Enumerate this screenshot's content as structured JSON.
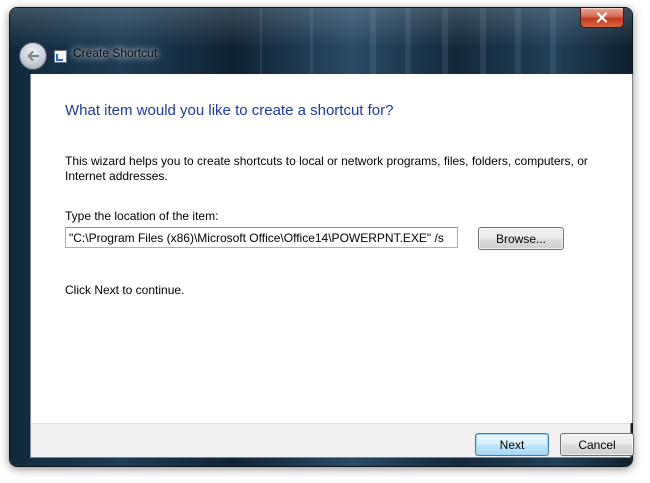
{
  "window": {
    "title": "Create Shortcut"
  },
  "titlebar": {
    "close_icon": "close-icon",
    "back_icon": "back-arrow-icon",
    "app_icon": "shortcut-icon"
  },
  "wizard": {
    "heading": "What item would you like to create a shortcut for?",
    "description": "This wizard helps you to create shortcuts to local or network programs, files, folders, computers, or Internet addresses.",
    "location_label": "Type the location of the item:",
    "location_value": "\"C:\\Program Files (x86)\\Microsoft Office\\Office14\\POWERPNT.EXE\" /s",
    "browse_label": "Browse...",
    "continue_text": "Click Next to continue."
  },
  "footer": {
    "next_label": "Next",
    "cancel_label": "Cancel"
  },
  "colors": {
    "heading": "#1c3a9e",
    "footer_bg": "#f0f0f0",
    "close_red": "#c0391f",
    "default_button_border": "#3c7fb1"
  }
}
